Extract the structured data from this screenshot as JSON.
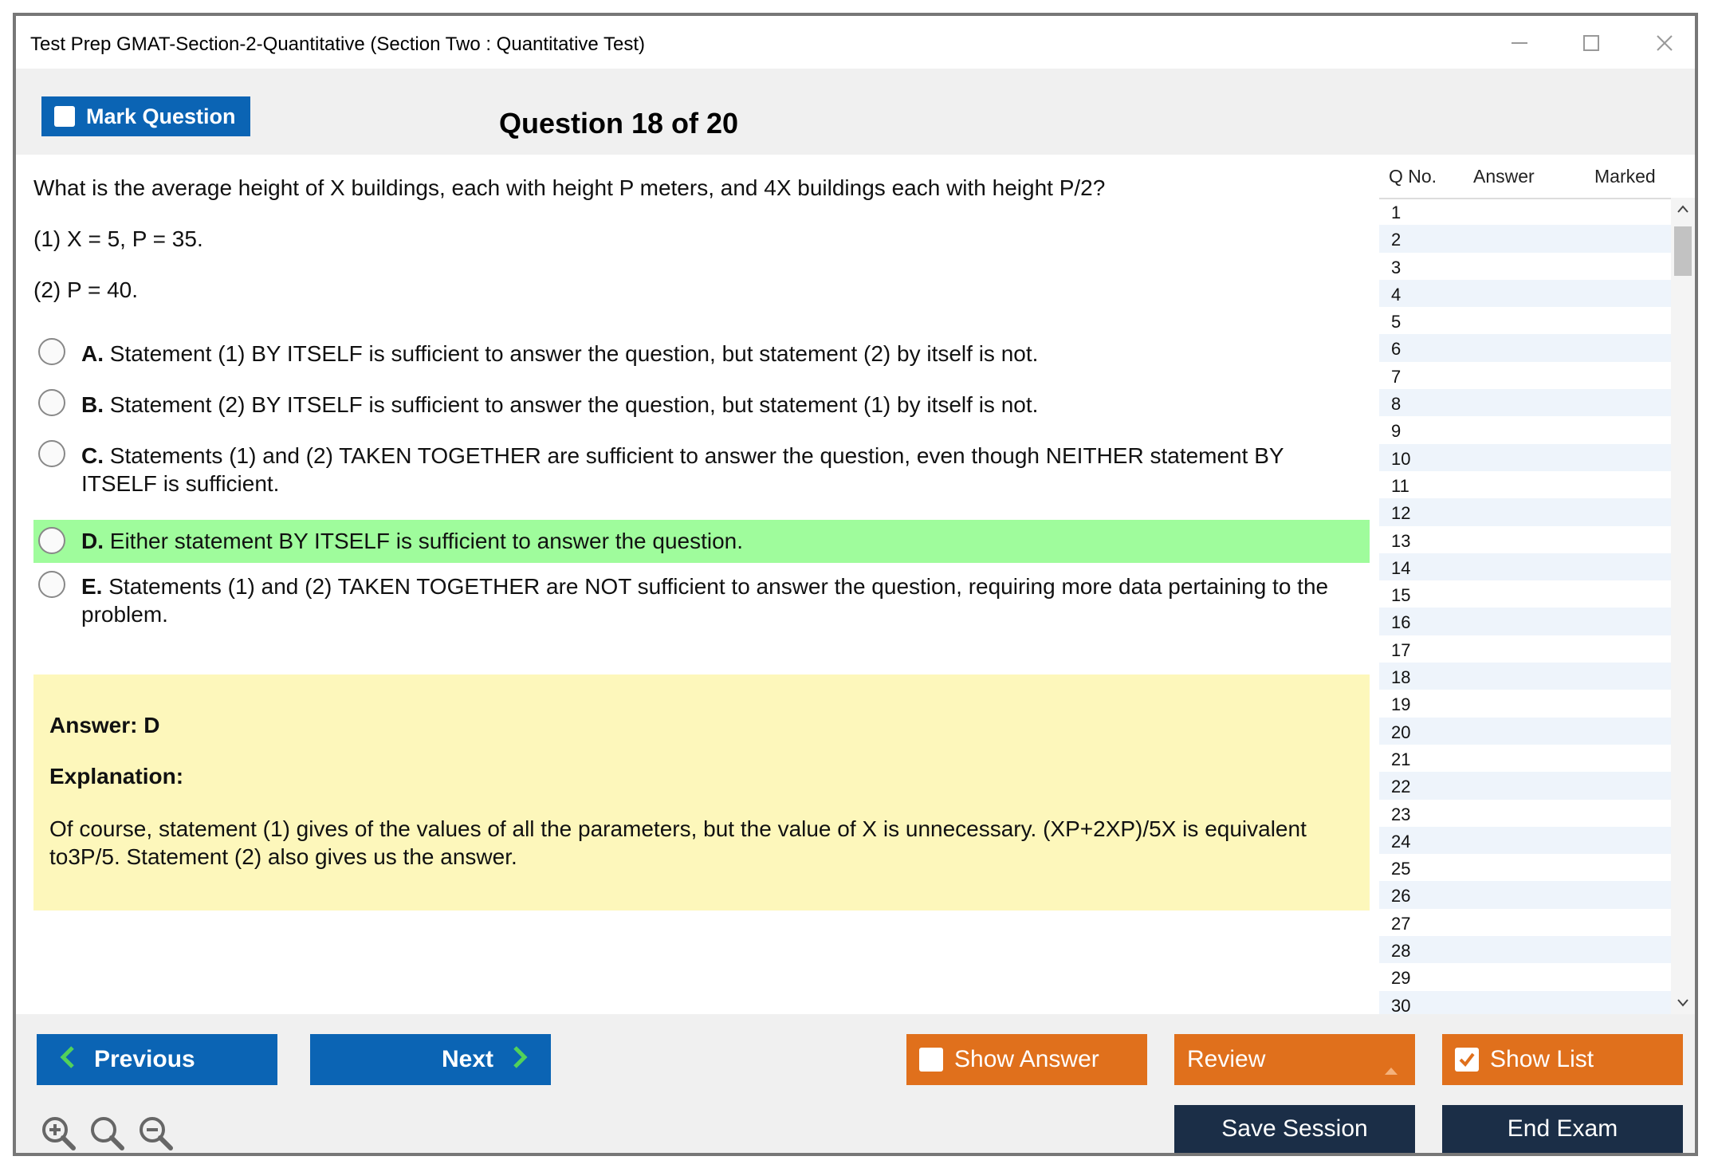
{
  "window": {
    "title": "Test Prep GMAT-Section-2-Quantitative (Section Two : Quantitative Test)",
    "minimize_icon": "minimize-icon",
    "maximize_icon": "maximize-icon",
    "close_icon": "close-icon"
  },
  "header": {
    "mark_label": "Mark Question",
    "question_counter": "Question 18 of 20"
  },
  "question": {
    "stem": "What is the average height of X buildings, each with height P meters, and 4X buildings each with height P/2?",
    "statement1": "(1) X = 5, P = 35.",
    "statement2": "(2) P = 40.",
    "options": [
      {
        "letter": "A.",
        "text": "Statement (1) BY ITSELF is sufficient to answer the question, but statement (2) by itself is not."
      },
      {
        "letter": "B.",
        "text": "Statement (2) BY ITSELF is sufficient to answer the question, but statement (1) by itself is not."
      },
      {
        "letter": "C.",
        "text": "Statements (1) and (2) TAKEN TOGETHER are sufficient to answer the question, even though NEITHER statement BY ITSELF is sufficient."
      },
      {
        "letter": "D.",
        "text": "Either statement BY ITSELF is sufficient to answer the question."
      },
      {
        "letter": "E.",
        "text": "Statements (1) and (2) TAKEN TOGETHER are NOT sufficient to answer the question, requiring more data pertaining to the problem."
      }
    ],
    "highlight_color": "#9ffc9c"
  },
  "answer": {
    "answer_line": "Answer: D",
    "explanation_label": "Explanation:",
    "explanation": "Of course, statement (1) gives of the values of all the parameters, but the value of X is unnecessary. (XP+2XP)/5X is equivalent to3P/5. Statement (2) also gives us the answer.",
    "background_color": "#fdf7bb"
  },
  "question_list": {
    "columns": [
      "Q No.",
      "Answer",
      "Marked"
    ],
    "rows": [
      "1",
      "2",
      "3",
      "4",
      "5",
      "6",
      "7",
      "8",
      "9",
      "10",
      "11",
      "12",
      "13",
      "14",
      "15",
      "16",
      "17",
      "18",
      "19",
      "20",
      "21",
      "22",
      "23",
      "24",
      "25",
      "26",
      "27",
      "28",
      "29",
      "30"
    ],
    "scroll_up_icon": "chevron-up-icon",
    "scroll_down_icon": "chevron-down-icon"
  },
  "footer": {
    "previous_label": "Previous",
    "next_label": "Next",
    "show_answer_label": "Show Answer",
    "review_label": "Review",
    "show_list_label": "Show List",
    "save_session_label": "Save Session",
    "end_exam_label": "End Exam",
    "zoom_icons": [
      "zoom-in-icon",
      "zoom-reset-icon",
      "zoom-out-icon"
    ],
    "colors": {
      "blue": "#0b64b4",
      "orange": "#e0701c",
      "navy": "#1b2e47"
    }
  }
}
